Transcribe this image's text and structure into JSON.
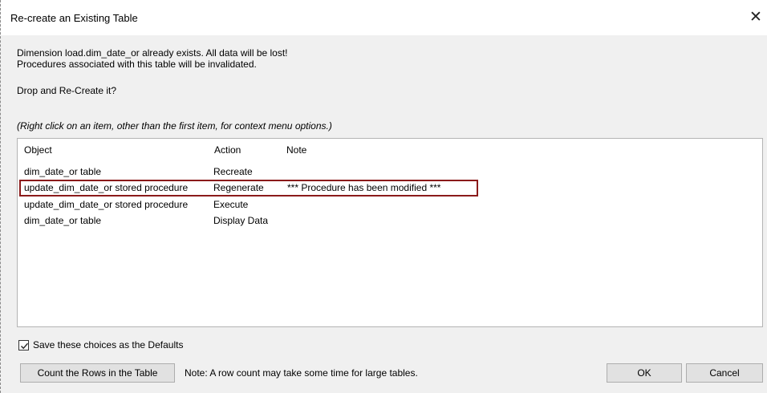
{
  "dialog": {
    "title": "Re-create an Existing Table",
    "close_symbol": "✕",
    "message_line1": "Dimension load.dim_date_or already exists. All data will be lost!",
    "message_line2": "Procedures associated with this table will be invalidated.",
    "question": "Drop and Re-Create it?",
    "hint": "(Right click on an item, other than the first item, for context menu options.)"
  },
  "list": {
    "columns": {
      "object": "Object",
      "action": "Action",
      "note": "Note"
    },
    "rows": [
      {
        "object": "dim_date_or table",
        "action": "Recreate",
        "note": ""
      },
      {
        "object": "update_dim_date_or stored procedure",
        "action": "Regenerate",
        "note": "*** Procedure has been modified ***"
      },
      {
        "object": "update_dim_date_or stored procedure",
        "action": "Execute",
        "note": ""
      },
      {
        "object": "dim_date_or table",
        "action": "Display Data",
        "note": ""
      }
    ],
    "highlight_color": "#8b1a1a"
  },
  "footer": {
    "save_defaults_label": "Save these choices as the Defaults",
    "save_defaults_checked": true,
    "count_button_label": "Count the Rows in the Table",
    "count_note": "Note: A row count may take some time for large tables.",
    "ok_label": "OK",
    "cancel_label": "Cancel"
  }
}
